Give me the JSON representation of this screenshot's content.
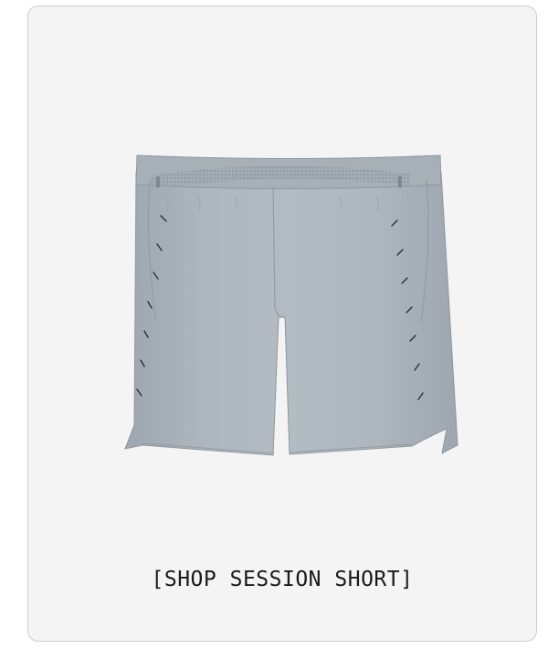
{
  "product": {
    "image_alt": "session short",
    "color_hex": "#a9b1b9"
  },
  "cta": {
    "label": "[SHOP SESSION SHORT]"
  }
}
